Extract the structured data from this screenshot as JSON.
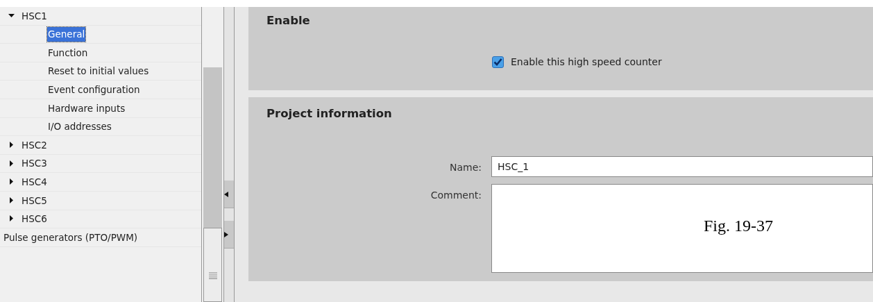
{
  "tree": {
    "items": [
      {
        "label": "HSC1",
        "expanded": true,
        "children": [
          {
            "label": "General",
            "selected": true
          },
          {
            "label": "Function",
            "selected": false
          },
          {
            "label": "Reset to initial values",
            "selected": false
          },
          {
            "label": "Event configuration",
            "selected": false
          },
          {
            "label": "Hardware inputs",
            "selected": false
          },
          {
            "label": "I/O addresses",
            "selected": false
          }
        ]
      },
      {
        "label": "HSC2",
        "expanded": false
      },
      {
        "label": "HSC3",
        "expanded": false
      },
      {
        "label": "HSC4",
        "expanded": false
      },
      {
        "label": "HSC5",
        "expanded": false
      },
      {
        "label": "HSC6",
        "expanded": false
      },
      {
        "label": "Pulse generators (PTO/PWM)"
      }
    ]
  },
  "sections": [
    {
      "kind": "checkbox",
      "title": "Enable",
      "checkbox": {
        "label": "Enable this high speed counter",
        "checked": true
      }
    },
    {
      "kind": "form",
      "title": "Project information",
      "fields": [
        {
          "kind": "line",
          "label": "Name:",
          "value": "HSC_1"
        },
        {
          "kind": "area",
          "label": "Comment:"
        }
      ]
    }
  ],
  "figure_caption": "Fig. 19-37"
}
